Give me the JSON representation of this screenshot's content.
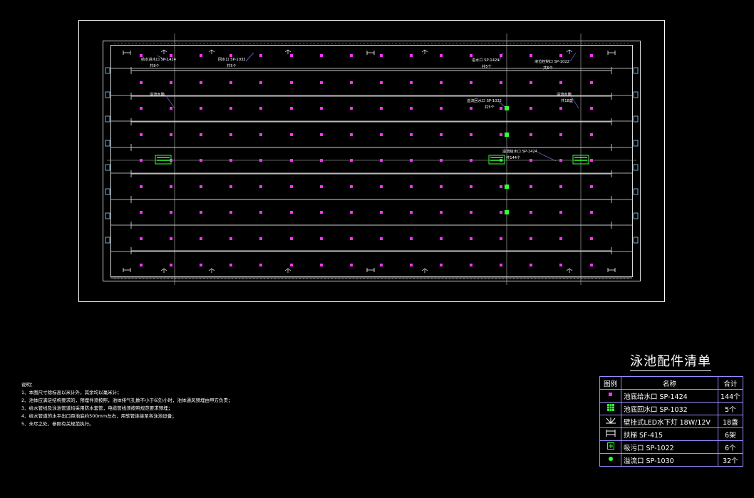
{
  "drawing": {
    "colors": {
      "background": "#000000",
      "frame": "#ffffff",
      "pool_line": "#d8d8d8",
      "lane_line": "#e0e0e0",
      "inlet": "#ff33ff",
      "drain": "#33ff33",
      "overflow": "#33ff33",
      "annotation": "#ffffff",
      "leader": "#8888ff",
      "table_border": "#9a8cff"
    },
    "lanes": 8,
    "inlet_columns": 16,
    "inlet_rows": 9,
    "drain_count": 5
  },
  "annotations": [
    "给水进水口 SP-1424",
    "共8个",
    "回水口 SP-1032",
    "共5个",
    "进水口 SP-1424",
    "共5个",
    "液位控制口 SP-1022",
    "共5个",
    "溢流水箱",
    "溢流回水口 SP-1032",
    "共5个",
    "溢流给水口 SP-1424",
    "共144个",
    "水下灯 SP-1022",
    "共18盏"
  ],
  "notes": {
    "title": "说明：",
    "lines": [
      "1、本图尺寸除标高以米计外，其余均以毫米计；",
      "2、池体应满足结构要求的，预埋件须按照，池体排气孔数不小于6次/小时，池体通风预埋由甲方负责；",
      "3、给水管线及泳池管道均采用防水套管，电缆管线须按照规范要求预埋；",
      "4、给水管道的水平出口距池底约500mm左右，用软管连接至各泳池设备；",
      "5、未尽之处，参照有关规范执行。"
    ]
  },
  "legend": {
    "title": "泳池配件清单",
    "header": {
      "symbol": "图例",
      "name": "名称",
      "count": "合计"
    },
    "rows": [
      {
        "icon": "magenta-square-icon",
        "name": "池底给水口 SP-1424",
        "count": "144个"
      },
      {
        "icon": "green-grid-square-icon",
        "name": "池底回水口 SP-1032",
        "count": "5个"
      },
      {
        "icon": "underwater-light-icon",
        "name": "壁挂式LED水下灯 18W/12V",
        "count": "18盏"
      },
      {
        "icon": "ladder-icon",
        "name": "扶梯 SF-415",
        "count": "6架"
      },
      {
        "icon": "drain-box-icon",
        "name": "吸污口 SP-1022",
        "count": "6个"
      },
      {
        "icon": "green-dot-icon",
        "name": "溢流口 SP-1030",
        "count": "32个"
      }
    ]
  }
}
